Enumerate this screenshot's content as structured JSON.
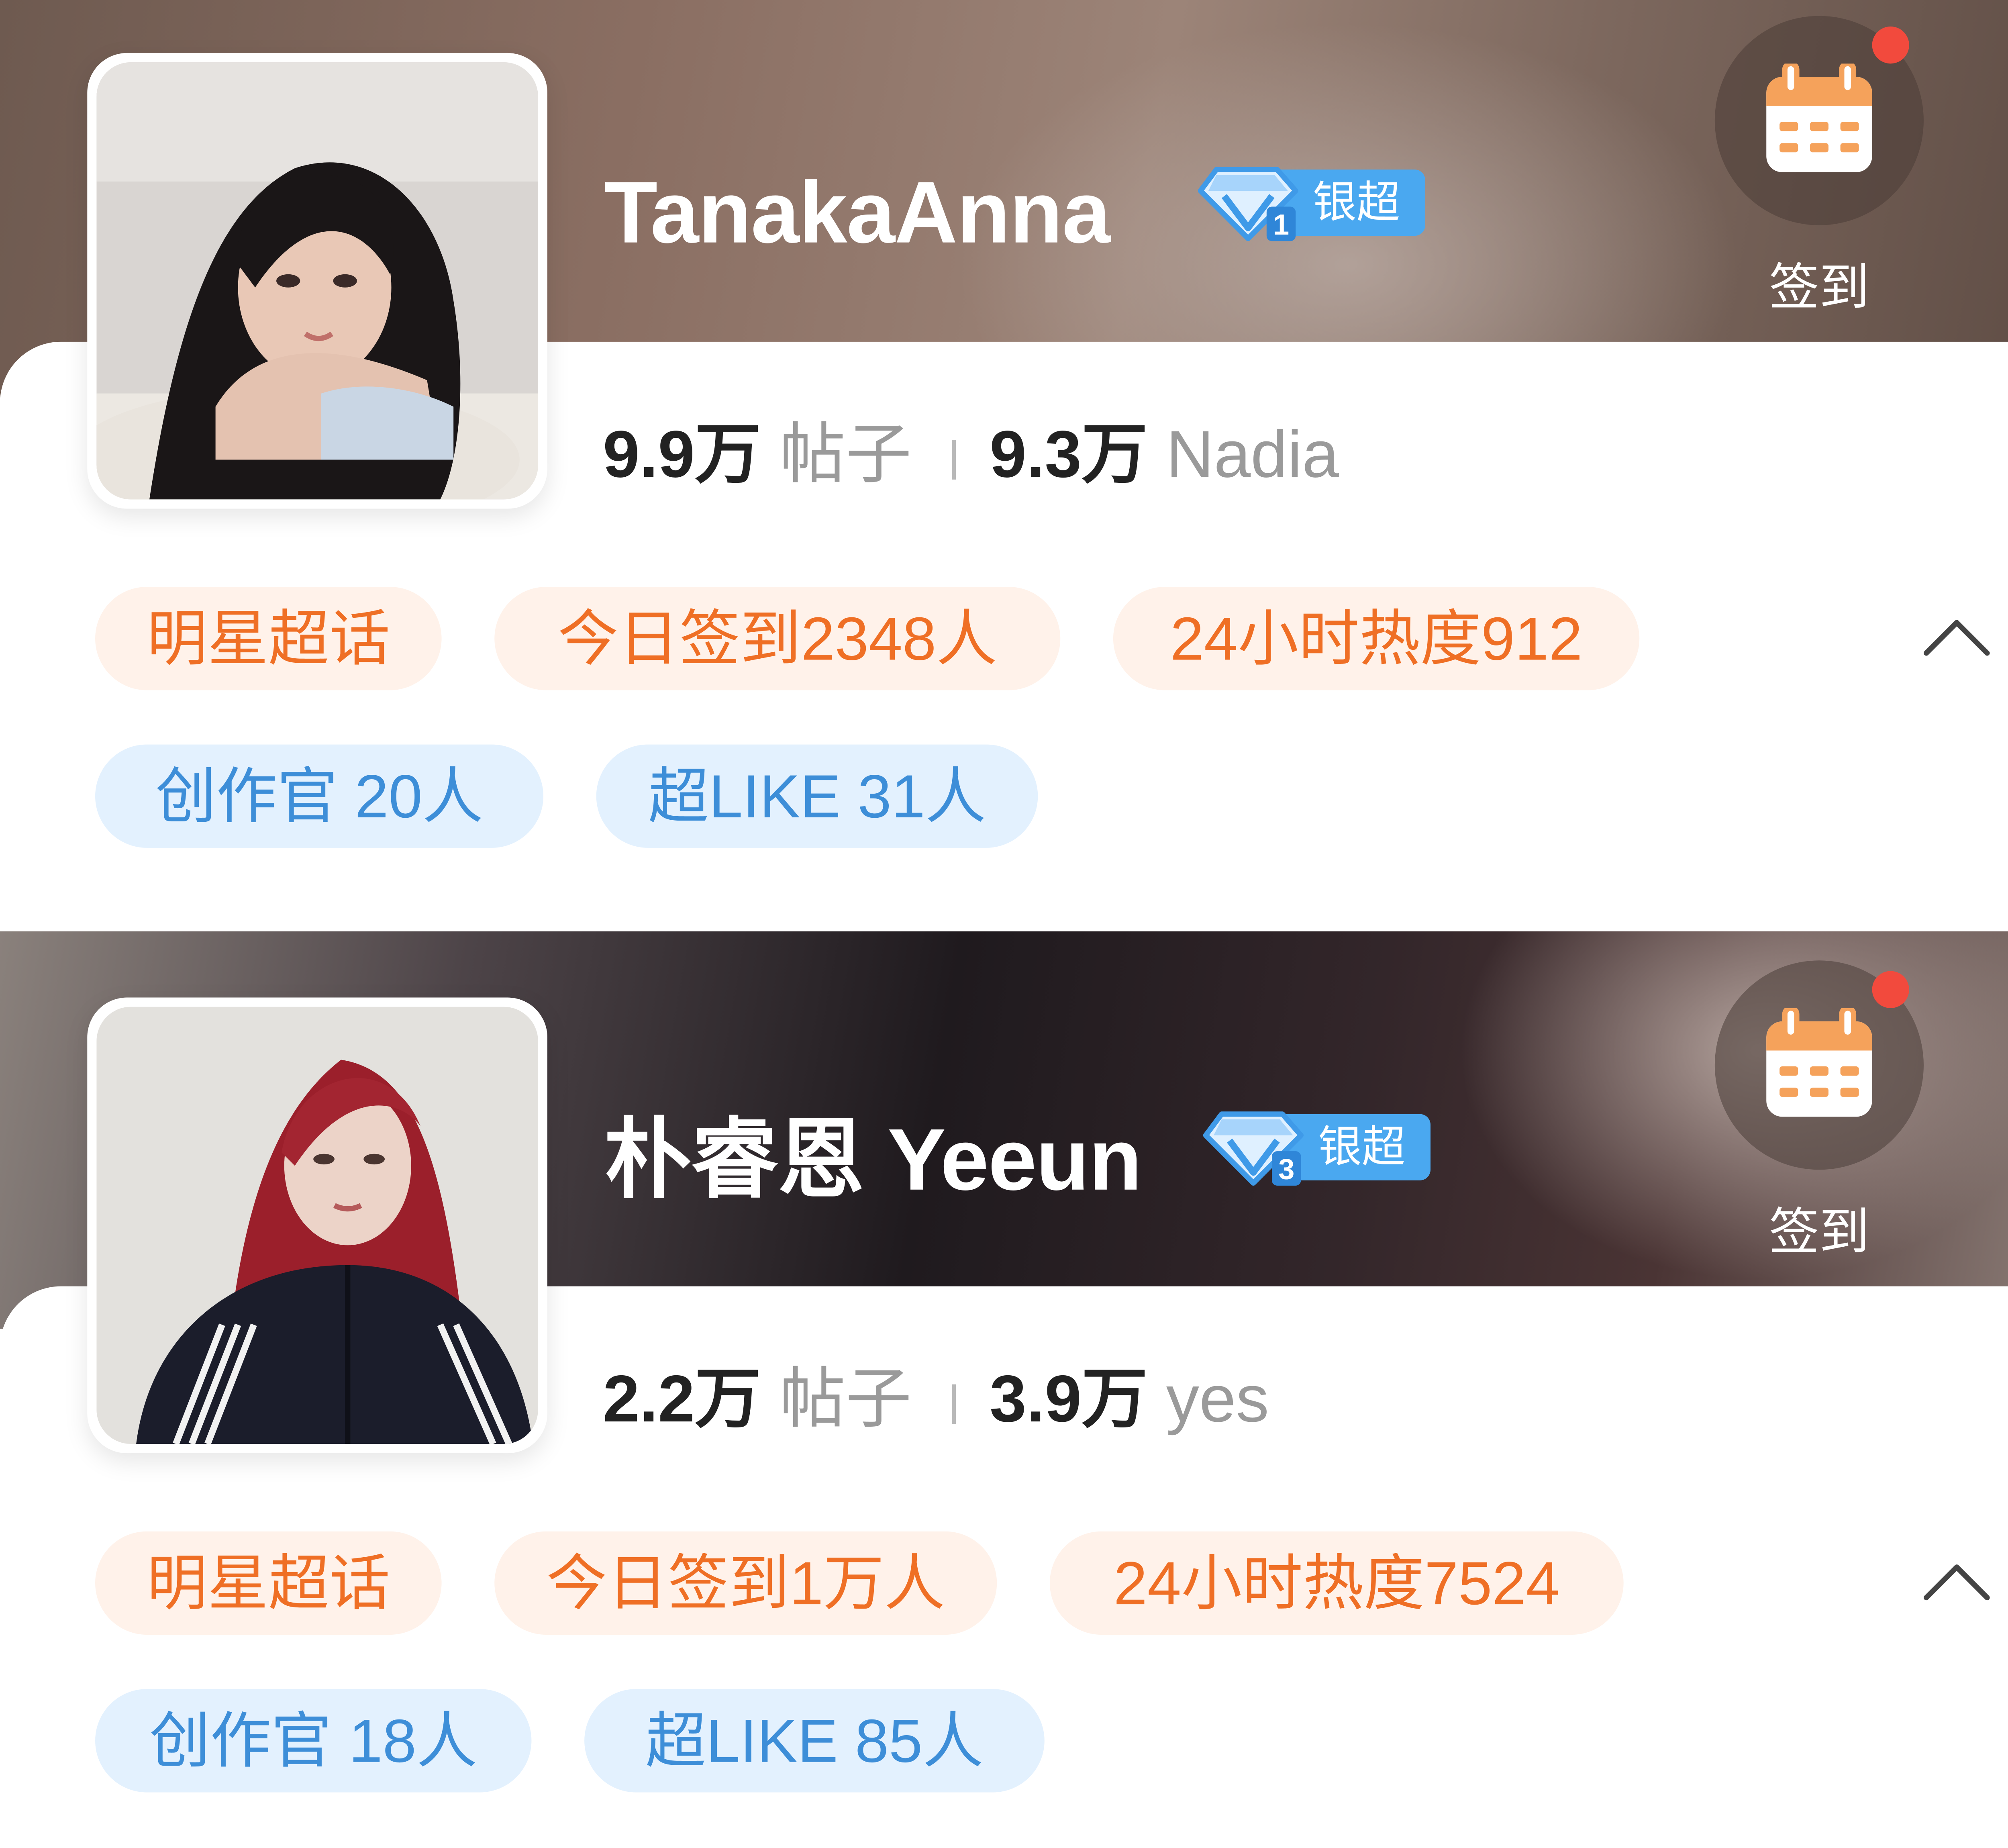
{
  "cards": [
    {
      "name": "TanakaAnna",
      "level_badge": "银超",
      "level_number": "1",
      "checkin_label": "签到",
      "stats": {
        "posts_value": "9.9万",
        "posts_label": "帖子",
        "fans_value": "9.3万",
        "fans_label": "Nadia"
      },
      "orange_tags": [
        "明星超话",
        "今日签到2348人",
        "24小时热度912"
      ],
      "blue_tags": [
        "创作官 20人",
        "超LIKE 31人"
      ]
    },
    {
      "name": "朴睿恩 Yeeun",
      "level_badge": "银超",
      "level_number": "3",
      "checkin_label": "签到",
      "stats": {
        "posts_value": "2.2万",
        "posts_label": "帖子",
        "fans_value": "3.9万",
        "fans_label": "yes"
      },
      "orange_tags": [
        "明星超话",
        "今日签到1万人",
        "24小时热度7524"
      ],
      "blue_tags": [
        "创作官 18人",
        "超LIKE 85人"
      ]
    }
  ],
  "icons": {
    "level": "diamond-icon",
    "checkin": "calendar-icon",
    "notification": "red-dot-icon",
    "collapse": "chevron-up-icon"
  },
  "colors": {
    "tag_orange_text": "#ef6f25",
    "tag_orange_bg": "#fff2ea",
    "tag_blue_text": "#3d8ed8",
    "tag_blue_bg": "#e3f1fe",
    "badge_blue": "#4aa8f0",
    "calendar_orange": "#f5a25b",
    "notification_red": "#f24a3d"
  }
}
